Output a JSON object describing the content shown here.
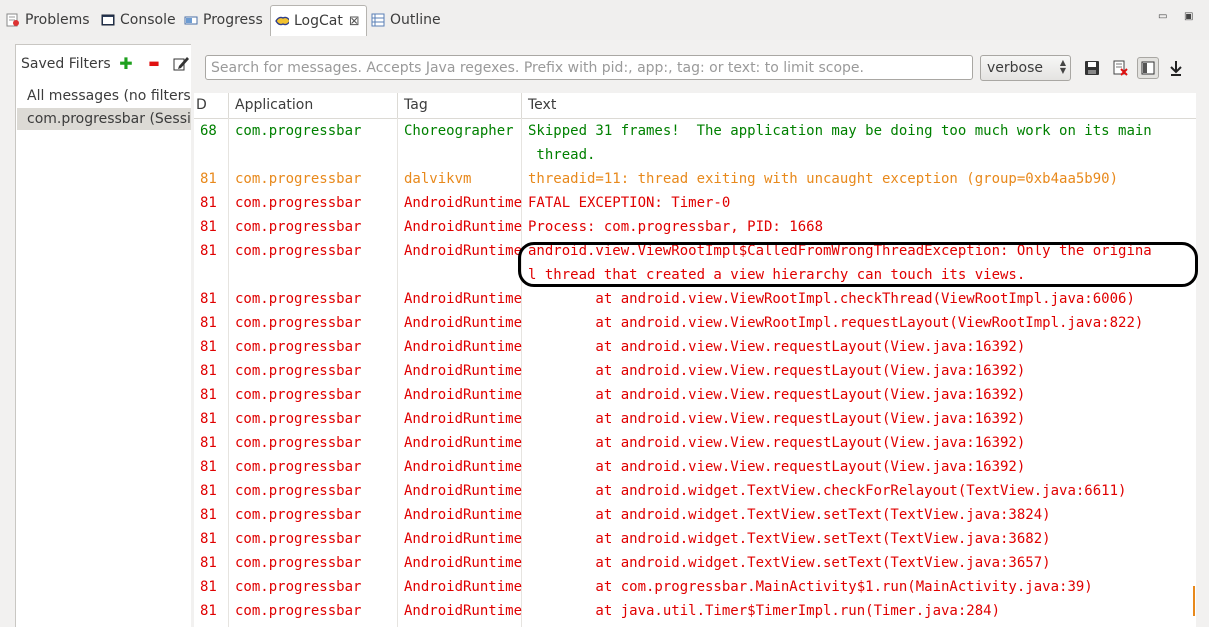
{
  "tabs": [
    {
      "label": "Problems",
      "icon": "problems-icon",
      "active": false
    },
    {
      "label": "Console",
      "icon": "console-icon",
      "active": false
    },
    {
      "label": "Progress",
      "icon": "progress-icon",
      "active": false
    },
    {
      "label": "LogCat",
      "icon": "logcat-icon",
      "active": true,
      "close": "⊠"
    },
    {
      "label": "Outline",
      "icon": "outline-icon",
      "active": false
    }
  ],
  "window_controls": {
    "minimize": "▭",
    "maximize": "▣"
  },
  "saved_filters": {
    "title": "Saved Filters",
    "add_symbol": "✚",
    "remove_symbol": "▬",
    "items": [
      {
        "label": "All messages (no filters)",
        "selected": false
      },
      {
        "label": "com.progressbar (Session Filter)",
        "selected": true
      }
    ]
  },
  "toolbar": {
    "search_placeholder": "Search for messages. Accepts Java regexes. Prefix with pid:, app:, tag: or text: to limit scope.",
    "search_value": "",
    "log_level": "verbose"
  },
  "columns": {
    "pid": "D",
    "application": "Application",
    "tag": "Tag",
    "text": "Text"
  },
  "colors": {
    "info": "#008000",
    "warn": "#e8891c",
    "error": "#e00000"
  },
  "rows": [
    {
      "pid": "68",
      "app": "com.progressbar",
      "tag": "Choreographer",
      "level": "I",
      "lines": [
        "Skipped 31 frames!  The application may be doing too much work on its main",
        " thread."
      ]
    },
    {
      "pid": "81",
      "app": "com.progressbar",
      "tag": "dalvikvm",
      "level": "W",
      "lines": [
        "threadid=11: thread exiting with uncaught exception (group=0xb4aa5b90)"
      ]
    },
    {
      "pid": "81",
      "app": "com.progressbar",
      "tag": "AndroidRuntime",
      "level": "E",
      "lines": [
        "FATAL EXCEPTION: Timer-0"
      ]
    },
    {
      "pid": "81",
      "app": "com.progressbar",
      "tag": "AndroidRuntime",
      "level": "E",
      "lines": [
        "Process: com.progressbar, PID: 1668"
      ]
    },
    {
      "pid": "81",
      "app": "com.progressbar",
      "tag": "AndroidRuntime",
      "level": "E",
      "lines": [
        "android.view.ViewRootImpl$CalledFromWrongThreadException: Only the origina",
        "l thread that created a view hierarchy can touch its views."
      ]
    },
    {
      "pid": "81",
      "app": "com.progressbar",
      "tag": "AndroidRuntime",
      "level": "E",
      "lines": [
        "        at android.view.ViewRootImpl.checkThread(ViewRootImpl.java:6006)"
      ]
    },
    {
      "pid": "81",
      "app": "com.progressbar",
      "tag": "AndroidRuntime",
      "level": "E",
      "lines": [
        "        at android.view.ViewRootImpl.requestLayout(ViewRootImpl.java:822)"
      ]
    },
    {
      "pid": "81",
      "app": "com.progressbar",
      "tag": "AndroidRuntime",
      "level": "E",
      "lines": [
        "        at android.view.View.requestLayout(View.java:16392)"
      ]
    },
    {
      "pid": "81",
      "app": "com.progressbar",
      "tag": "AndroidRuntime",
      "level": "E",
      "lines": [
        "        at android.view.View.requestLayout(View.java:16392)"
      ]
    },
    {
      "pid": "81",
      "app": "com.progressbar",
      "tag": "AndroidRuntime",
      "level": "E",
      "lines": [
        "        at android.view.View.requestLayout(View.java:16392)"
      ]
    },
    {
      "pid": "81",
      "app": "com.progressbar",
      "tag": "AndroidRuntime",
      "level": "E",
      "lines": [
        "        at android.view.View.requestLayout(View.java:16392)"
      ]
    },
    {
      "pid": "81",
      "app": "com.progressbar",
      "tag": "AndroidRuntime",
      "level": "E",
      "lines": [
        "        at android.view.View.requestLayout(View.java:16392)"
      ]
    },
    {
      "pid": "81",
      "app": "com.progressbar",
      "tag": "AndroidRuntime",
      "level": "E",
      "lines": [
        "        at android.view.View.requestLayout(View.java:16392)"
      ]
    },
    {
      "pid": "81",
      "app": "com.progressbar",
      "tag": "AndroidRuntime",
      "level": "E",
      "lines": [
        "        at android.widget.TextView.checkForRelayout(TextView.java:6611)"
      ]
    },
    {
      "pid": "81",
      "app": "com.progressbar",
      "tag": "AndroidRuntime",
      "level": "E",
      "lines": [
        "        at android.widget.TextView.setText(TextView.java:3824)"
      ]
    },
    {
      "pid": "81",
      "app": "com.progressbar",
      "tag": "AndroidRuntime",
      "level": "E",
      "lines": [
        "        at android.widget.TextView.setText(TextView.java:3682)"
      ]
    },
    {
      "pid": "81",
      "app": "com.progressbar",
      "tag": "AndroidRuntime",
      "level": "E",
      "lines": [
        "        at android.widget.TextView.setText(TextView.java:3657)"
      ]
    },
    {
      "pid": "81",
      "app": "com.progressbar",
      "tag": "AndroidRuntime",
      "level": "E",
      "lines": [
        "        at com.progressbar.MainActivity$1.run(MainActivity.java:39)"
      ]
    },
    {
      "pid": "81",
      "app": "com.progressbar",
      "tag": "AndroidRuntime",
      "level": "E",
      "lines": [
        "        at java.util.Timer$TimerImpl.run(Timer.java:284)"
      ]
    }
  ]
}
